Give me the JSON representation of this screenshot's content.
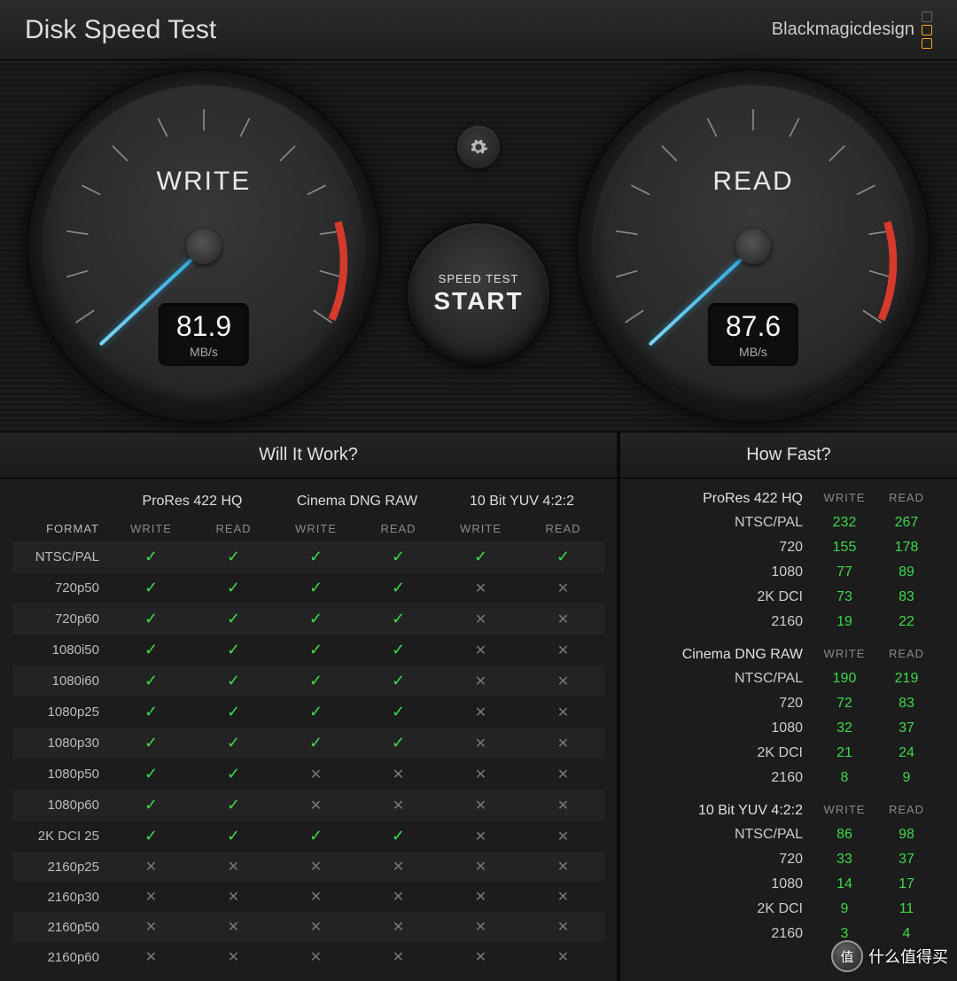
{
  "header": {
    "title": "Disk Speed Test",
    "brand": "Blackmagicdesign"
  },
  "gauges": {
    "write": {
      "label": "WRITE",
      "value": "81.9",
      "unit": "MB/s",
      "angle": 137
    },
    "read": {
      "label": "READ",
      "value": "87.6",
      "unit": "MB/s",
      "angle": 137
    }
  },
  "controls": {
    "speed_test_label": "SPEED TEST",
    "start_label": "START"
  },
  "panels": {
    "will_it_work": "Will It Work?",
    "how_fast": "How Fast?"
  },
  "headers": {
    "format": "FORMAT",
    "write": "WRITE",
    "read": "READ"
  },
  "codecs": [
    "ProRes 422 HQ",
    "Cinema DNG RAW",
    "10 Bit YUV 4:2:2"
  ],
  "formats": [
    "NTSC/PAL",
    "720p50",
    "720p60",
    "1080i50",
    "1080i60",
    "1080p25",
    "1080p30",
    "1080p50",
    "1080p60",
    "2K DCI 25",
    "2160p25",
    "2160p30",
    "2160p50",
    "2160p60"
  ],
  "results": [
    [
      [
        true,
        true
      ],
      [
        true,
        true
      ],
      [
        true,
        true
      ]
    ],
    [
      [
        true,
        true
      ],
      [
        true,
        true
      ],
      [
        false,
        false
      ]
    ],
    [
      [
        true,
        true
      ],
      [
        true,
        true
      ],
      [
        false,
        false
      ]
    ],
    [
      [
        true,
        true
      ],
      [
        true,
        true
      ],
      [
        false,
        false
      ]
    ],
    [
      [
        true,
        true
      ],
      [
        true,
        true
      ],
      [
        false,
        false
      ]
    ],
    [
      [
        true,
        true
      ],
      [
        true,
        true
      ],
      [
        false,
        false
      ]
    ],
    [
      [
        true,
        true
      ],
      [
        true,
        true
      ],
      [
        false,
        false
      ]
    ],
    [
      [
        true,
        true
      ],
      [
        false,
        false
      ],
      [
        false,
        false
      ]
    ],
    [
      [
        true,
        true
      ],
      [
        false,
        false
      ],
      [
        false,
        false
      ]
    ],
    [
      [
        true,
        true
      ],
      [
        true,
        true
      ],
      [
        false,
        false
      ]
    ],
    [
      [
        false,
        false
      ],
      [
        false,
        false
      ],
      [
        false,
        false
      ]
    ],
    [
      [
        false,
        false
      ],
      [
        false,
        false
      ],
      [
        false,
        false
      ]
    ],
    [
      [
        false,
        false
      ],
      [
        false,
        false
      ],
      [
        false,
        false
      ]
    ],
    [
      [
        false,
        false
      ],
      [
        false,
        false
      ],
      [
        false,
        false
      ]
    ]
  ],
  "howfast_labels": [
    "NTSC/PAL",
    "720",
    "1080",
    "2K DCI",
    "2160"
  ],
  "howfast": {
    "ProRes 422 HQ": [
      [
        232,
        267
      ],
      [
        155,
        178
      ],
      [
        77,
        89
      ],
      [
        73,
        83
      ],
      [
        19,
        22
      ]
    ],
    "Cinema DNG RAW": [
      [
        190,
        219
      ],
      [
        72,
        83
      ],
      [
        32,
        37
      ],
      [
        21,
        24
      ],
      [
        8,
        9
      ]
    ],
    "10 Bit YUV 4:2:2": [
      [
        86,
        98
      ],
      [
        33,
        37
      ],
      [
        14,
        17
      ],
      [
        9,
        11
      ],
      [
        3,
        4
      ]
    ]
  },
  "watermark": "什么值得买"
}
